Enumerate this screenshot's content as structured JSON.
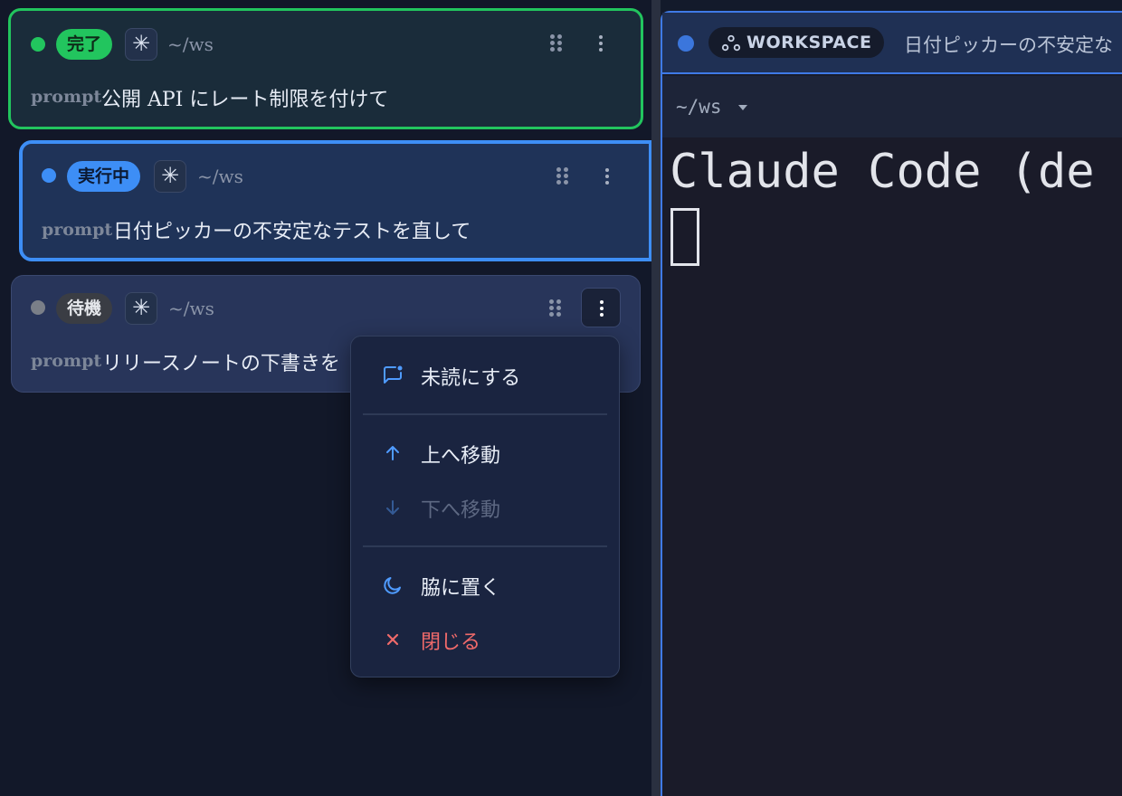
{
  "sessions": [
    {
      "status": "完了",
      "path": "~/ws",
      "prompt_label": "prompt",
      "prompt": "公開 API にレート制限を付けて"
    },
    {
      "status": "実行中",
      "path": "~/ws",
      "prompt_label": "prompt",
      "prompt": "日付ピッカーの不安定なテストを直して"
    },
    {
      "status": "待機",
      "path": "~/ws",
      "prompt_label": "prompt",
      "prompt": "リリースノートの下書きを"
    }
  ],
  "menu": {
    "mark_unread": "未読にする",
    "move_up": "上へ移動",
    "move_down": "下へ移動",
    "set_aside": "脇に置く",
    "close": "閉じる"
  },
  "terminal": {
    "workspace_label": "WORKSPACE",
    "tab_title": "日付ピッカーの不安定な",
    "path": "~/ws",
    "output": "Claude Code (de"
  },
  "colors": {
    "done": "#22c55e",
    "running": "#3d8ef6",
    "waiting": "#7a7f88",
    "danger": "#f06a6a"
  },
  "icons": [
    "sparkle-icon",
    "drag-handle-icon",
    "more-vert-icon",
    "message-unread-icon",
    "arrow-up-icon",
    "arrow-down-icon",
    "moon-icon",
    "close-icon",
    "workspace-icon",
    "chevron-down-icon"
  ]
}
